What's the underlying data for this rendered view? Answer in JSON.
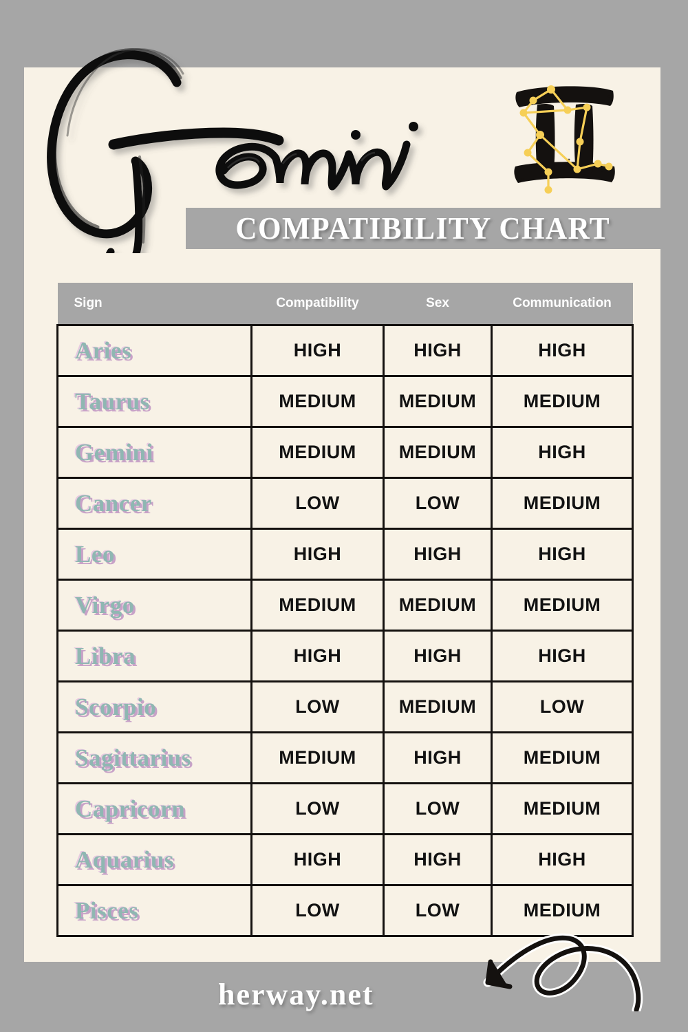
{
  "page": {
    "background_color": "#a6a6a6",
    "panel_color": "#f8f2e6",
    "accent_gray": "#a6a6a6",
    "sign_text_color": "#8fb7b2",
    "sign_shadow_color": "#c8a2c8",
    "constellation_color": "#f6cf57"
  },
  "header": {
    "title": "Gemini",
    "subtitle": "COMPATIBILITY CHART",
    "zodiac_symbol": "♊",
    "zodiac_name": "gemini-constellation-icon"
  },
  "table": {
    "columns": [
      "Sign",
      "Compatibility",
      "Sex",
      "Communication"
    ],
    "rows": [
      {
        "sign": "Aries",
        "compatibility": "HIGH",
        "sex": "HIGH",
        "communication": "HIGH"
      },
      {
        "sign": "Taurus",
        "compatibility": "MEDIUM",
        "sex": "MEDIUM",
        "communication": "MEDIUM"
      },
      {
        "sign": "Gemini",
        "compatibility": "MEDIUM",
        "sex": "MEDIUM",
        "communication": "HIGH"
      },
      {
        "sign": "Cancer",
        "compatibility": "LOW",
        "sex": "LOW",
        "communication": "MEDIUM"
      },
      {
        "sign": "Leo",
        "compatibility": "HIGH",
        "sex": "HIGH",
        "communication": "HIGH"
      },
      {
        "sign": "Virgo",
        "compatibility": "MEDIUM",
        "sex": "MEDIUM",
        "communication": "MEDIUM"
      },
      {
        "sign": "Libra",
        "compatibility": "HIGH",
        "sex": "HIGH",
        "communication": "HIGH"
      },
      {
        "sign": "Scorpio",
        "compatibility": "LOW",
        "sex": "MEDIUM",
        "communication": "LOW"
      },
      {
        "sign": "Sagittarius",
        "compatibility": "MEDIUM",
        "sex": "HIGH",
        "communication": "MEDIUM"
      },
      {
        "sign": "Capricorn",
        "compatibility": "LOW",
        "sex": "LOW",
        "communication": "MEDIUM"
      },
      {
        "sign": "Aquarius",
        "compatibility": "HIGH",
        "sex": "HIGH",
        "communication": "HIGH"
      },
      {
        "sign": "Pisces",
        "compatibility": "LOW",
        "sex": "LOW",
        "communication": "MEDIUM"
      }
    ]
  },
  "footer": {
    "brand": "herway.net",
    "arrow": "curly-arrow-icon"
  }
}
